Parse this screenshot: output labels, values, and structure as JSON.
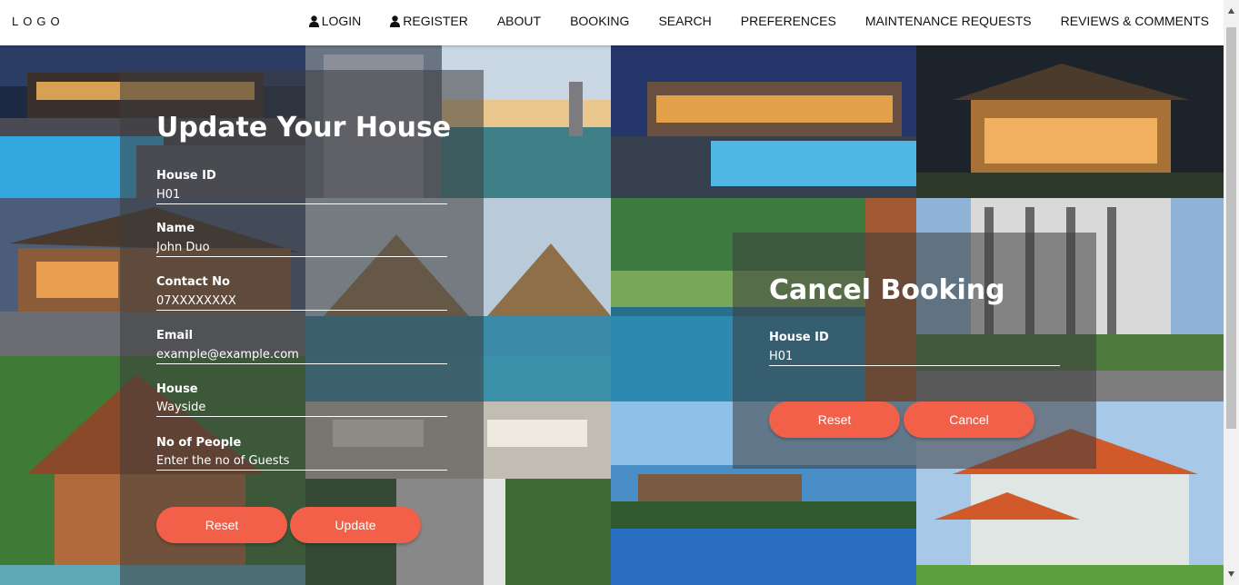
{
  "nav": {
    "logo": "LOGO",
    "items": [
      {
        "label": "LOGIN",
        "icon": "user-icon"
      },
      {
        "label": "REGISTER",
        "icon": "user-icon"
      },
      {
        "label": "ABOUT"
      },
      {
        "label": "BOOKING"
      },
      {
        "label": "SEARCH"
      },
      {
        "label": "PREFERENCES"
      },
      {
        "label": "MAINTENANCE REQUESTS"
      },
      {
        "label": "REVIEWS & COMMENTS"
      }
    ]
  },
  "update_form": {
    "title": "Update Your House",
    "fields": [
      {
        "label": "House ID",
        "value": "H01"
      },
      {
        "label": "Name",
        "value": "John Duo"
      },
      {
        "label": "Contact No",
        "value": "07XXXXXXXX"
      },
      {
        "label": "Email",
        "value": "example@example.com"
      },
      {
        "label": "House",
        "value": "Wayside"
      },
      {
        "label": "No of People",
        "placeholder": "Enter the no of Guests"
      }
    ],
    "reset_label": "Reset",
    "submit_label": "Update"
  },
  "cancel_form": {
    "title": "Cancel Booking",
    "fields": [
      {
        "label": "House ID",
        "value": "H01"
      }
    ],
    "reset_label": "Reset",
    "submit_label": "Cancel"
  },
  "colors": {
    "accent": "#f2604a",
    "panel_overlay": "rgba(60,60,60,0.55)"
  }
}
